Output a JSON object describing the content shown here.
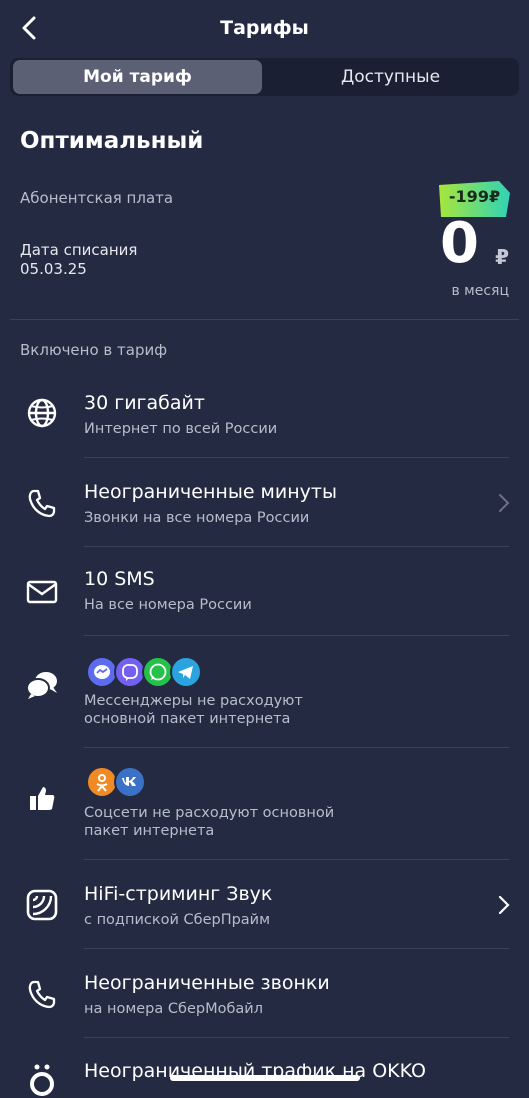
{
  "header": {
    "title": "Тарифы"
  },
  "tabs": [
    {
      "label": "Мой тариф"
    },
    {
      "label": "Доступные"
    }
  ],
  "plan": {
    "name": "Оптимальный",
    "fee_label": "Абонентская плата",
    "date_label": "Дата списания",
    "date_value": "05.03.25",
    "discount": "-199₽",
    "price": "0",
    "currency": "₽",
    "period": "в месяц"
  },
  "included_label": "Включено в тариф",
  "items": [
    {
      "icon": "globe-icon",
      "title": "30 гигабайт",
      "subtitle": "Интернет по всей России"
    },
    {
      "icon": "phone-icon",
      "title": "Неограниченные минуты",
      "subtitle": "Звонки на все номера России"
    },
    {
      "icon": "envelope-icon",
      "title": "10 SMS",
      "subtitle": "На все номера России"
    },
    {
      "icon": "chat-bubbles-icon",
      "apps": [
        "messenger-icon",
        "viber-icon",
        "whatsapp-icon",
        "telegram-icon"
      ],
      "subtitle1": "Мессенджеры не расходуют",
      "subtitle2": "основной пакет интернета"
    },
    {
      "icon": "thumbs-up-icon",
      "apps": [
        "odnoklassniki-icon",
        "vk-icon"
      ],
      "subtitle1": "Соцсети не расходуют основной",
      "subtitle2": "пакет интернета"
    },
    {
      "icon": "streaming-icon",
      "title": "HiFi-стриминг Звук",
      "subtitle": "с подпиской СберПрайм"
    },
    {
      "icon": "phone-icon",
      "title": "Неограниченные звонки",
      "subtitle": "на номера СберМобайл"
    },
    {
      "icon": "okko-icon",
      "title": "Неограниченный трафик на OKKO"
    }
  ],
  "colors": {
    "background": "#242a42",
    "segment_bg": "#1a1f33",
    "active_tab": "#5b6074",
    "discount_start": "#a8e63a",
    "discount_end": "#2ed3b7"
  }
}
